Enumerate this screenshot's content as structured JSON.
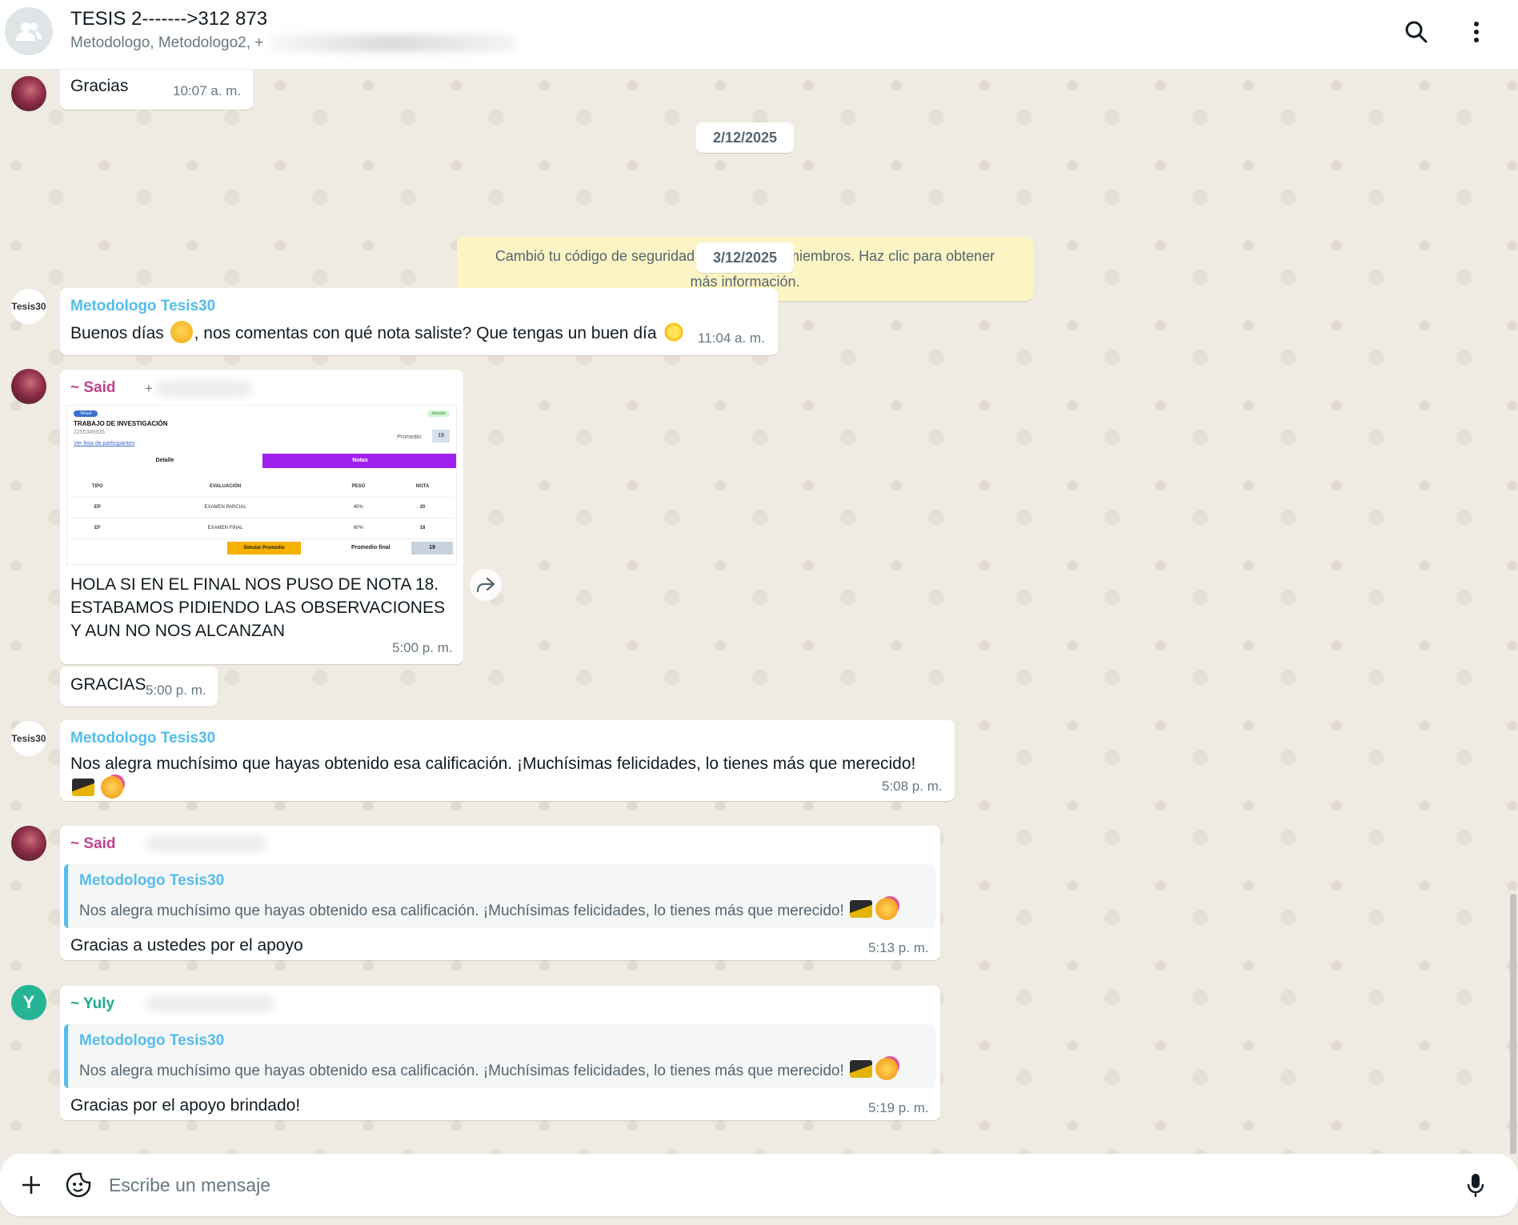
{
  "header": {
    "title": "TESIS 2------->312 873",
    "subtitle": "Metodologo, Metodologo2, +",
    "icons": {
      "group": "group-avatar-icon",
      "search": "search-icon",
      "menu": "more-vertical-icon"
    }
  },
  "dates": [
    "2/12/2025",
    "3/12/2025"
  ],
  "system_message": "Cambió tu código de seguridad con todos los miembros. Haz clic para obtener más información.",
  "messages": {
    "m1": {
      "text": "Gracias",
      "time": "10:07 a. m."
    },
    "m2": {
      "sender": "Metodologo Tesis30",
      "text_a": "Buenos días",
      "text_b": ", nos comentas con qué nota saliste? Que tengas un buen día",
      "time": "11:04 a. m."
    },
    "m3": {
      "sender": "~ Said",
      "sender_plus": "+",
      "image": {
        "badge_virtual": "Virtual",
        "badge_status": "Iniciado",
        "title": "TRABAJO DE INVESTIGACIÓN",
        "code": "2255346935",
        "link": "Ver lista de participantes",
        "avg_label": "Promedio:",
        "avg_value": "19",
        "tab_detail": "Detalle",
        "tab_notes": "Notas",
        "headers": [
          "TIPO",
          "EVALUACIÓN",
          "PESO",
          "NOTA"
        ],
        "rows": [
          [
            "EP",
            "EXAMEN PARCIAL",
            "40%",
            "20"
          ],
          [
            "EF",
            "EXAMEN FINAL",
            "60%",
            "18"
          ]
        ],
        "simulate": "Simular Promedio",
        "final_label": "Promedio final",
        "final_value": "19"
      },
      "text": "HOLA SI EN EL FINAL NOS PUSO DE NOTA 18. ESTABAMOS PIDIENDO LAS OBSERVACIONES Y AUN NO NOS ALCANZAN",
      "time": "5:00 p. m."
    },
    "m4": {
      "text": "GRACIAS",
      "time": "5:00 p. m."
    },
    "m5": {
      "sender": "Metodologo Tesis30",
      "text": "Nos alegra muchísimo que hayas obtenido esa calificación. ¡Muchísimas felicidades, lo tienes más que merecido!",
      "time": "5:08 p. m."
    },
    "m6": {
      "sender": "~ Said",
      "quote_sender": "Metodologo Tesis30",
      "quote_text": "Nos alegra muchísimo que hayas obtenido esa calificación. ¡Muchísimas felicidades, lo tienes más que merecido!",
      "text": "Gracias a ustedes por el apoyo",
      "time": "5:13 p. m."
    },
    "m7": {
      "sender": "~ Yuly",
      "avatar_letter": "Y",
      "quote_sender": "Metodologo Tesis30",
      "quote_text": "Nos alegra muchísimo que hayas obtenido esa calificación. ¡Muchísimas felicidades, lo tienes más que merecido!",
      "text": "Gracias por el apoyo brindado!",
      "time": "5:19 p. m."
    }
  },
  "logo_text": "Tesis30",
  "composer": {
    "placeholder": "Escribe un mensaje",
    "icons": {
      "attach": "plus-icon",
      "sticker": "sticker-icon",
      "mic": "microphone-icon"
    }
  },
  "colors": {
    "chat_bg": "#efeae2",
    "metodologo_name": "#53bdeb",
    "said_name": "#c2418e",
    "yuly_name": "#1fa98b",
    "system_bg": "#fdf4c5",
    "notes_tab": "#a021ef"
  }
}
